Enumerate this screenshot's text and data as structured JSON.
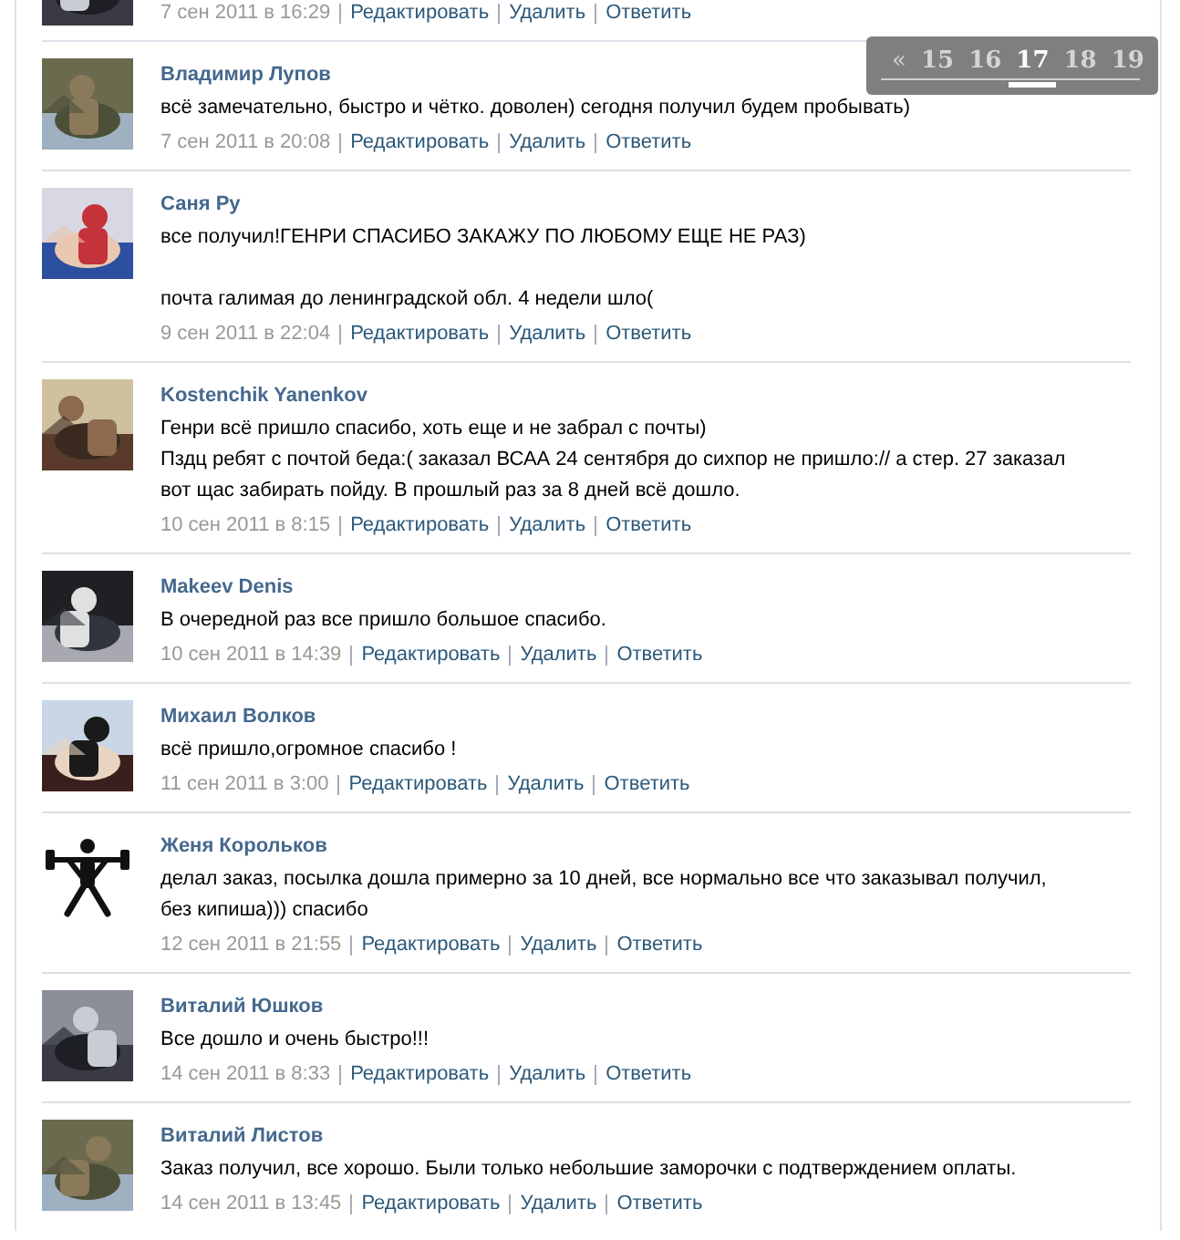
{
  "pagination": [
    {
      "label": "«",
      "selected": false
    },
    {
      "label": "15",
      "selected": false
    },
    {
      "label": "16",
      "selected": false
    },
    {
      "label": "17",
      "selected": true
    },
    {
      "label": "18",
      "selected": false
    },
    {
      "label": "19",
      "selected": false
    }
  ],
  "top_post": {
    "date": "7 сен 2011 в 16:29",
    "actions": [
      "Редактировать",
      "Удалить",
      "Ответить"
    ]
  },
  "posts": [
    {
      "author": "Владимир Лупов",
      "text": "всё замечательно, быстро и чётко. доволен) сегодня получил будем пробывать)",
      "date": "7 сен 2011 в 20:08",
      "actions": [
        "Редактировать",
        "Удалить",
        "Ответить"
      ]
    },
    {
      "author": "Саня Ру",
      "text": "все получил!ГЕНРИ СПАСИБО ЗАКАЖУ ПО ЛЮБОМУ ЕЩЕ НЕ РАЗ)\n\nпочта галимая до ленинградской обл. 4 недели шло(",
      "date": "9 сен 2011 в 22:04",
      "actions": [
        "Редактировать",
        "Удалить",
        "Ответить"
      ]
    },
    {
      "author": "Kostenchik Yanenkov",
      "text": "Генри всё пришло спасибо, хоть еще и не забрал с почты)\nПздц ребят с почтой беда:( заказал ВСАА 24 сентября до сихпор не пришло:// а стер. 27 заказал вот щас забирать пойду. В прошлый раз за 8 дней всё дошло.",
      "date": "10 сен 2011 в 8:15",
      "actions": [
        "Редактировать",
        "Удалить",
        "Ответить"
      ]
    },
    {
      "author": "Makeev Denis",
      "text": "В очередной раз все пришло большое спасибо.",
      "date": "10 сен 2011 в 14:39",
      "actions": [
        "Редактировать",
        "Удалить",
        "Ответить"
      ]
    },
    {
      "author": "Михаил Волков",
      "text": "всё пришло,огромное спасибо !",
      "date": "11 сен 2011 в 3:00",
      "actions": [
        "Редактировать",
        "Удалить",
        "Ответить"
      ]
    },
    {
      "author": "Женя Корольков",
      "avatar": {
        "kind": "icon"
      },
      "text": "делал заказ, посылка дошла примерно за 10 дней, все нормально все что заказывал получил, без кипиша))) спасибо",
      "date": "12 сен 2011 в 21:55",
      "actions": [
        "Редактировать",
        "Удалить",
        "Ответить"
      ]
    },
    {
      "author": "Виталий Юшков",
      "text": "Все дошло и очень быстро!!!",
      "date": "14 сен 2011 в 8:33",
      "actions": [
        "Редактировать",
        "Удалить",
        "Ответить"
      ]
    },
    {
      "author": "Виталий Листов",
      "text": "Заказ получил, все хорошо. Были только небольшие заморочки с подтверждением оплаты.",
      "date": "14 сен 2011 в 13:45",
      "actions": [
        "Редактировать",
        "Удалить",
        "Ответить"
      ]
    }
  ]
}
